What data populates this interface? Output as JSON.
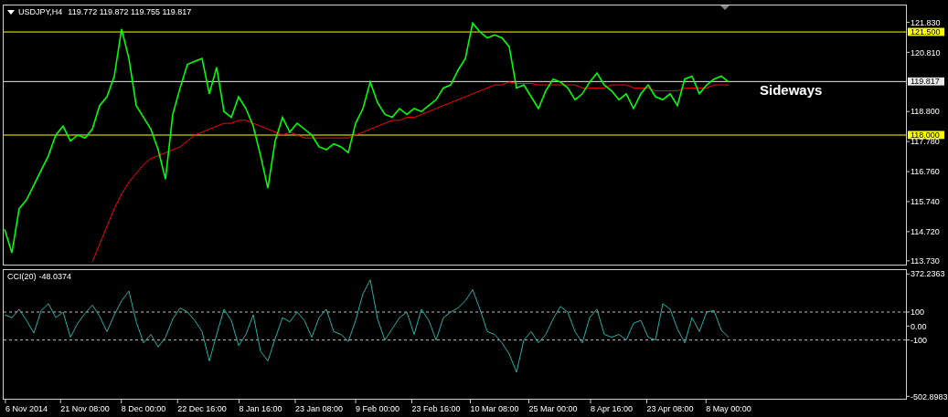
{
  "price_panel": {
    "title": "USDJPY,H4",
    "reading": "119.772 119.872 119.755 119.817",
    "chart_data": {
      "type": "line",
      "ylim": [
        113.6,
        122.4
      ],
      "yticks": [
        {
          "value": 121.83,
          "label": "121.830"
        },
        {
          "value": 120.81,
          "label": "120.810"
        },
        {
          "value": 118.8,
          "label": "118.800"
        },
        {
          "value": 117.78,
          "label": "117.780"
        },
        {
          "value": 116.76,
          "label": "116.760"
        },
        {
          "value": 115.74,
          "label": "115.740"
        },
        {
          "value": 114.72,
          "label": "114.720"
        },
        {
          "value": 113.73,
          "label": "113.730"
        }
      ],
      "series": [
        {
          "color": "#00ff00",
          "values": [
            114.8,
            114.0,
            115.5,
            115.8,
            116.3,
            116.8,
            117.3,
            118.0,
            118.3,
            117.8,
            118.0,
            117.9,
            118.2,
            119.0,
            119.3,
            120.0,
            121.6,
            120.6,
            119.0,
            118.6,
            118.2,
            117.5,
            116.5,
            118.7,
            119.6,
            120.4,
            120.5,
            120.6,
            119.4,
            120.3,
            118.8,
            118.6,
            119.3,
            118.9,
            118.3,
            117.3,
            116.2,
            117.8,
            118.6,
            118.1,
            118.4,
            118.2,
            118.0,
            117.6,
            117.5,
            117.7,
            117.6,
            117.4,
            118.4,
            118.9,
            119.8,
            119.1,
            118.7,
            118.6,
            118.9,
            118.7,
            118.9,
            118.8,
            119.0,
            119.2,
            119.6,
            119.7,
            120.2,
            120.6,
            121.8,
            121.5,
            121.3,
            121.4,
            121.3,
            121.0,
            119.6,
            119.7,
            119.3,
            118.9,
            119.5,
            119.9,
            119.8,
            119.6,
            119.2,
            119.4,
            119.8,
            120.1,
            119.7,
            119.5,
            119.2,
            119.4,
            118.9,
            119.4,
            119.7,
            119.3,
            119.2,
            119.4,
            119.0,
            119.9,
            120.0,
            119.4,
            119.7,
            119.9,
            120.0,
            119.8
          ]
        },
        {
          "color": "#ff0000",
          "values": [
            null,
            null,
            null,
            null,
            null,
            null,
            null,
            null,
            null,
            null,
            null,
            null,
            113.7,
            114.3,
            114.9,
            115.5,
            116.0,
            116.4,
            116.7,
            117.0,
            117.2,
            117.3,
            117.4,
            117.5,
            117.6,
            117.8,
            118.0,
            118.1,
            118.2,
            118.3,
            118.4,
            118.4,
            118.5,
            118.5,
            118.4,
            118.3,
            118.2,
            118.1,
            118.0,
            118.1,
            118.0,
            117.9,
            117.9,
            117.9,
            117.9,
            117.9,
            117.9,
            117.9,
            118.0,
            118.1,
            118.2,
            118.3,
            118.4,
            118.5,
            118.5,
            118.6,
            118.6,
            118.7,
            118.8,
            118.9,
            119.0,
            119.1,
            119.2,
            119.3,
            119.4,
            119.5,
            119.6,
            119.7,
            119.7,
            119.8,
            119.75,
            119.75,
            119.75,
            119.7,
            119.7,
            119.7,
            119.7,
            119.7,
            119.7,
            119.6,
            119.6,
            119.6,
            119.6,
            119.7,
            119.7,
            119.7,
            119.6,
            119.6,
            119.6,
            119.5,
            119.5,
            119.5,
            119.5,
            119.6,
            119.6,
            119.6,
            119.6,
            119.7,
            119.7,
            119.7
          ]
        }
      ],
      "ref_lines": [
        {
          "axis": "y",
          "value": 121.5,
          "label": "121.500",
          "color": "#ffff00"
        },
        {
          "axis": "y",
          "value": 119.817,
          "label": "119.817",
          "color": "#e8e8e8"
        },
        {
          "axis": "y",
          "value": 118.0,
          "label": "118.000",
          "color": "#ffff00"
        }
      ],
      "annotations": [
        "Sideways"
      ]
    }
  },
  "cci_panel": {
    "title": "CCI(20)",
    "reading": "-48.0374",
    "chart_data": {
      "type": "line",
      "ylim": [
        -520,
        400
      ],
      "categories": [
        null,
        null,
        null,
        "6 Nov 2014",
        null,
        null,
        null,
        null,
        null,
        null,
        null,
        "21 Nov 08:00",
        null,
        null,
        null,
        null,
        null,
        null,
        null,
        "8 Dec 00:00",
        null,
        null,
        null,
        null,
        null,
        null,
        null,
        "22 Dec 16:00",
        null,
        null,
        null,
        null,
        null,
        null,
        null,
        "8 Jan 16:00",
        null,
        null,
        null,
        null,
        null,
        null,
        null,
        "23 Jan 08:00",
        null,
        null,
        null,
        null,
        null,
        null,
        null,
        "9 Feb 00:00",
        null,
        null,
        null,
        null,
        null,
        null,
        null,
        "23 Feb 16:00",
        null,
        null,
        null,
        null,
        null,
        null,
        null,
        "10 Mar 08:00",
        null,
        null,
        null,
        null,
        null,
        null,
        null,
        "25 Mar 00:00",
        null,
        null,
        null,
        null,
        null,
        null,
        null,
        "8 Apr 16:00",
        null,
        null,
        null,
        null,
        null,
        null,
        null,
        "23 Apr 08:00",
        null,
        null,
        null,
        null,
        null,
        null,
        null,
        "8 May 00:00"
      ],
      "yticks": [
        {
          "value": 372.2363,
          "label": "372.2363"
        },
        {
          "value": 100,
          "label": "100"
        },
        {
          "value": 0,
          "label": "0.00"
        },
        {
          "value": -100,
          "label": "-100"
        },
        {
          "value": -502.8983,
          "label": "-502.8983"
        }
      ],
      "series": [
        {
          "color": "#20b2aa",
          "values": [
            80,
            60,
            120,
            40,
            -50,
            110,
            160,
            60,
            100,
            -80,
            20,
            90,
            150,
            70,
            -40,
            80,
            180,
            250,
            30,
            -120,
            -60,
            -150,
            -80,
            50,
            130,
            100,
            40,
            -40,
            -250,
            -60,
            120,
            40,
            -140,
            -60,
            80,
            -180,
            -250,
            -90,
            60,
            30,
            100,
            40,
            -80,
            60,
            120,
            -40,
            -60,
            -110,
            40,
            230,
            330,
            50,
            -100,
            -20,
            60,
            100,
            -60,
            120,
            40,
            -100,
            60,
            100,
            130,
            180,
            260,
            120,
            -40,
            -60,
            -120,
            -200,
            -330,
            -100,
            -40,
            -120,
            -60,
            50,
            140,
            100,
            -40,
            -120,
            60,
            120,
            -60,
            -80,
            -60,
            -100,
            20,
            40,
            -80,
            -100,
            160,
            120,
            -20,
            -120,
            60,
            -40,
            100,
            110,
            -30,
            -80
          ]
        }
      ],
      "ref_lines": [
        {
          "axis": "y",
          "value": 100,
          "color": "#c0c0c0"
        },
        {
          "axis": "y",
          "value": -100,
          "color": "#c0c0c0"
        }
      ]
    }
  }
}
